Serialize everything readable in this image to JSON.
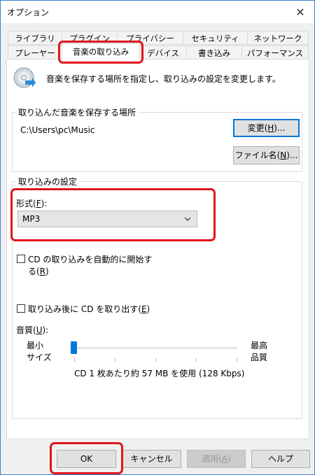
{
  "window": {
    "title": "オプション"
  },
  "tabs": {
    "row1": [
      {
        "label": "ライブラリ"
      },
      {
        "label": "プラグイン"
      },
      {
        "label": "プライバシー"
      },
      {
        "label": "セキュリティ"
      },
      {
        "label": "ネットワーク"
      }
    ],
    "row2": [
      {
        "label": "プレーヤー"
      },
      {
        "label": "音楽の取り込み"
      },
      {
        "label": "デバイス"
      },
      {
        "label": "書き込み"
      },
      {
        "label": "パフォーマンス"
      }
    ],
    "active": "音楽の取り込み"
  },
  "header": {
    "description": "音楽を保存する場所を指定し、取り込みの設定を変更します。",
    "icon": "rip-cd-icon"
  },
  "save_location": {
    "title": "取り込んだ音楽を保存する場所",
    "path": "C:\\Users\\pc\\Music",
    "change_button": "変更(H)...",
    "filename_button": "ファイル名(N)..."
  },
  "rip_settings": {
    "title": "取り込みの設定",
    "format_label": "形式(F):",
    "format_value": "MP3",
    "auto_rip_line1": "CD の取り込みを自動的に開始す",
    "auto_rip_line2": "る(R)",
    "auto_rip_checked": false,
    "eject_label": "取り込み後に CD を取り出す(E)",
    "eject_checked": false,
    "quality_label": "音質(U):",
    "quality_min_line1": "最小",
    "quality_min_line2": "サイズ",
    "quality_max_line1": "最高",
    "quality_max_line2": "品質",
    "quality_level": 0.0,
    "quality_info": "CD 1 枚あたり約 57 MB を使用 (128 Kbps)"
  },
  "footer": {
    "ok": "OK",
    "cancel": "キャンセル",
    "apply": "適用(A)",
    "help": "ヘルプ"
  },
  "colors": {
    "highlight": "#e0141b",
    "accent": "#0078d7"
  }
}
